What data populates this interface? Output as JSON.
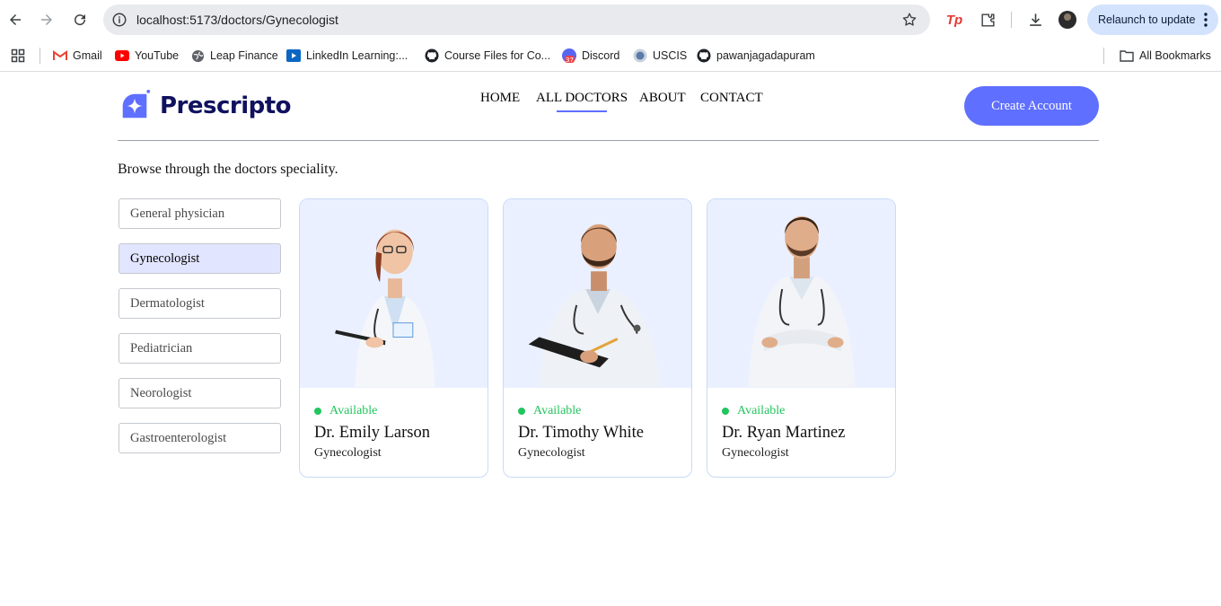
{
  "browser": {
    "url": "localhost:5173/doctors/Gynecologist",
    "relaunch_label": "Relaunch to update",
    "bookmarks": [
      "Gmail",
      "YouTube",
      "Leap Finance",
      "LinkedIn Learning:...",
      "Course Files for Co...",
      "Discord",
      "USCIS",
      "pawanjagadapuram"
    ],
    "all_bookmarks_label": "All Bookmarks",
    "discord_badge": "37"
  },
  "site": {
    "logo_text": "Prescripto",
    "nav": [
      "HOME",
      "ALL DOCTORS",
      "ABOUT",
      "CONTACT"
    ],
    "active_nav": "ALL DOCTORS",
    "create_account": "Create Account",
    "brand_color": "#5f6fff",
    "logo_color": "#10115e"
  },
  "page": {
    "intro": "Browse through the doctors speciality.",
    "specialities": [
      "General physician",
      "Gynecologist",
      "Dermatologist",
      "Pediatrician",
      "Neorologist",
      "Gastroenterologist"
    ],
    "selected_speciality": "Gynecologist",
    "doctors": [
      {
        "status": "Available",
        "name": "Dr. Emily Larson",
        "speciality": "Gynecologist"
      },
      {
        "status": "Available",
        "name": "Dr. Timothy White",
        "speciality": "Gynecologist"
      },
      {
        "status": "Available",
        "name": "Dr. Ryan Martinez",
        "speciality": "Gynecologist"
      }
    ],
    "available_color": "#22c55e"
  }
}
